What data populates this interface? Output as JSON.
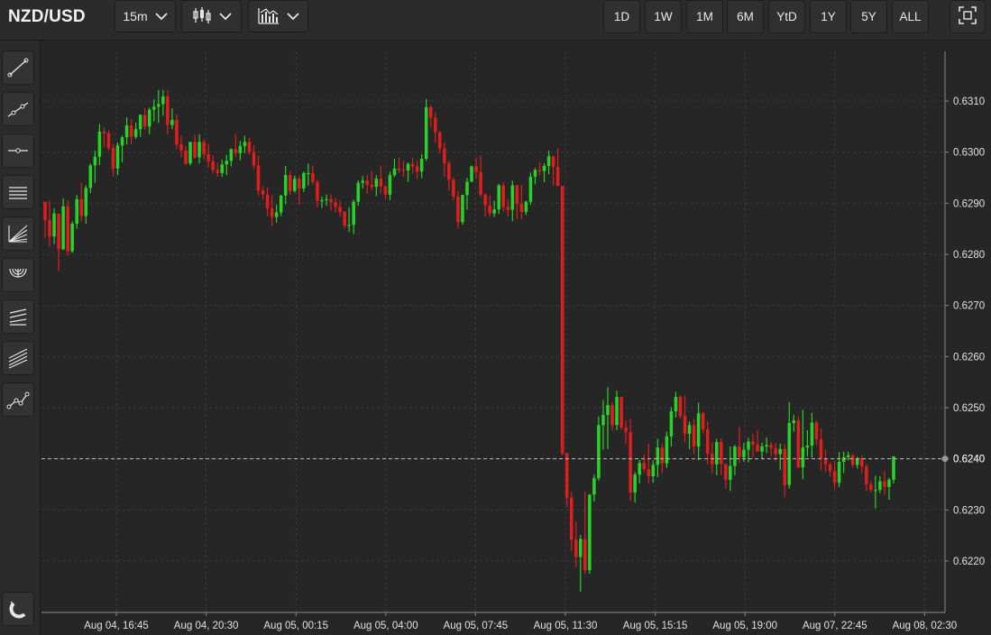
{
  "header": {
    "symbol": "NZD/USD",
    "interval": "15m",
    "chart_type_icon": "candlestick-icon",
    "indicators_icon": "indicators-icon",
    "ranges": [
      "1D",
      "1W",
      "1M",
      "6M",
      "YtD",
      "1Y",
      "5Y",
      "ALL"
    ],
    "fullscreen_icon": "fullscreen-icon"
  },
  "toolbar": {
    "tools": [
      "trend-line-icon",
      "extended-line-icon",
      "horizontal-line-icon",
      "parallel-channel-icon",
      "fan-icon",
      "arc-icon",
      "pitchfork-icon",
      "regression-channel-icon",
      "path-icon"
    ],
    "magnet_icon": "magnet-icon"
  },
  "colors": {
    "up": "#27d327",
    "down": "#e01e1e",
    "background": "#262626",
    "grid": "#3a3a3a",
    "axis_text": "#e0e0e0"
  },
  "chart_data": {
    "type": "candlestick",
    "ylim": [
      0.6212,
      0.6318
    ],
    "yticks": [
      "0.6220",
      "0.6230",
      "0.6240",
      "0.6250",
      "0.6260",
      "0.6270",
      "0.6280",
      "0.6290",
      "0.6300",
      "0.6310"
    ],
    "xticks": [
      "Aug 04, 16:45",
      "Aug 04, 20:30",
      "Aug 05, 00:15",
      "Aug 05, 04:00",
      "Aug 05, 07:45",
      "Aug 05, 11:30",
      "Aug 05, 15:15",
      "Aug 05, 19:00",
      "Aug 07, 22:45",
      "Aug 08, 02:30"
    ],
    "current_price": "0.6240",
    "candles": [
      [
        0.62903,
        0.62895,
        0.62832,
        0.62867
      ],
      [
        0.62867,
        0.62905,
        0.62815,
        0.62835
      ],
      [
        0.62835,
        0.6289,
        0.6282,
        0.6288
      ],
      [
        0.6288,
        0.62875,
        0.62767,
        0.6281
      ],
      [
        0.6281,
        0.6291,
        0.62808,
        0.62894
      ],
      [
        0.62894,
        0.62906,
        0.62797,
        0.62806
      ],
      [
        0.62806,
        0.62865,
        0.62803,
        0.6286
      ],
      [
        0.6286,
        0.62916,
        0.6285,
        0.62908
      ],
      [
        0.62908,
        0.6294,
        0.62864,
        0.62875
      ],
      [
        0.62875,
        0.62935,
        0.6286,
        0.6293
      ],
      [
        0.6293,
        0.62978,
        0.6292,
        0.62974
      ],
      [
        0.62974,
        0.63003,
        0.6294,
        0.62991
      ],
      [
        0.62991,
        0.63055,
        0.62975,
        0.6304
      ],
      [
        0.6304,
        0.63048,
        0.6301,
        0.63037
      ],
      [
        0.63037,
        0.63043,
        0.63003,
        0.63008
      ],
      [
        0.63008,
        0.63016,
        0.62953,
        0.62968
      ],
      [
        0.62968,
        0.63019,
        0.62955,
        0.63013
      ],
      [
        0.63013,
        0.63032,
        0.6298,
        0.63029
      ],
      [
        0.63029,
        0.63068,
        0.63015,
        0.63052
      ],
      [
        0.63052,
        0.63065,
        0.63015,
        0.6303
      ],
      [
        0.6303,
        0.63058,
        0.63026,
        0.63045
      ],
      [
        0.63045,
        0.63074,
        0.6303,
        0.63073
      ],
      [
        0.63073,
        0.63086,
        0.63044,
        0.6305
      ],
      [
        0.6305,
        0.63087,
        0.63035,
        0.63083
      ],
      [
        0.63083,
        0.63103,
        0.6306,
        0.63089
      ],
      [
        0.63089,
        0.63122,
        0.63057,
        0.63094
      ],
      [
        0.63094,
        0.63122,
        0.63071,
        0.63109
      ],
      [
        0.63109,
        0.63121,
        0.63035,
        0.63053
      ],
      [
        0.63053,
        0.63086,
        0.63045,
        0.63063
      ],
      [
        0.63063,
        0.63074,
        0.63006,
        0.63015
      ],
      [
        0.63015,
        0.63032,
        0.6299,
        0.63003
      ],
      [
        0.63003,
        0.63012,
        0.62975,
        0.62978
      ],
      [
        0.62978,
        0.6302,
        0.62974,
        0.6302
      ],
      [
        0.6302,
        0.63034,
        0.62987,
        0.6299
      ],
      [
        0.6299,
        0.63035,
        0.62978,
        0.6302
      ],
      [
        0.6302,
        0.63025,
        0.62986,
        0.62996
      ],
      [
        0.62996,
        0.63016,
        0.6297,
        0.62982
      ],
      [
        0.62982,
        0.62994,
        0.62958,
        0.62965
      ],
      [
        0.62965,
        0.62979,
        0.62952,
        0.62959
      ],
      [
        0.62959,
        0.62985,
        0.62952,
        0.62976
      ],
      [
        0.62976,
        0.62995,
        0.62955,
        0.62983
      ],
      [
        0.62983,
        0.63007,
        0.62972,
        0.63006
      ],
      [
        0.63006,
        0.63035,
        0.6299,
        0.62998
      ],
      [
        0.62998,
        0.63022,
        0.62984,
        0.63012
      ],
      [
        0.63012,
        0.63032,
        0.62998,
        0.6302
      ],
      [
        0.6302,
        0.63028,
        0.62995,
        0.63
      ],
      [
        0.63,
        0.63013,
        0.62967,
        0.62974
      ],
      [
        0.62974,
        0.62993,
        0.62915,
        0.62925
      ],
      [
        0.62925,
        0.62933,
        0.62907,
        0.62917
      ],
      [
        0.62917,
        0.62931,
        0.62875,
        0.6289
      ],
      [
        0.6289,
        0.62915,
        0.62856,
        0.62873
      ],
      [
        0.62873,
        0.62897,
        0.62862,
        0.62882
      ],
      [
        0.62882,
        0.62917,
        0.62875,
        0.62915
      ],
      [
        0.62915,
        0.62973,
        0.62898,
        0.62955
      ],
      [
        0.62955,
        0.62963,
        0.62916,
        0.62924
      ],
      [
        0.62924,
        0.62954,
        0.62921,
        0.62948
      ],
      [
        0.62948,
        0.62954,
        0.62897,
        0.62929
      ],
      [
        0.62929,
        0.62962,
        0.62922,
        0.62959
      ],
      [
        0.62959,
        0.62978,
        0.62935,
        0.62959
      ],
      [
        0.62959,
        0.62974,
        0.62936,
        0.62942
      ],
      [
        0.62942,
        0.62946,
        0.62892,
        0.62905
      ],
      [
        0.62905,
        0.62913,
        0.62891,
        0.62906
      ],
      [
        0.62906,
        0.62917,
        0.62895,
        0.62908
      ],
      [
        0.62908,
        0.62917,
        0.62886,
        0.62902
      ],
      [
        0.62902,
        0.6291,
        0.62882,
        0.62893
      ],
      [
        0.62893,
        0.62905,
        0.62873,
        0.62883
      ],
      [
        0.62883,
        0.62885,
        0.62851,
        0.62856
      ],
      [
        0.62856,
        0.62892,
        0.62844,
        0.62858
      ],
      [
        0.62858,
        0.62907,
        0.6284,
        0.62903
      ],
      [
        0.62903,
        0.62945,
        0.62895,
        0.6294
      ],
      [
        0.6294,
        0.62953,
        0.62929,
        0.62944
      ],
      [
        0.62944,
        0.62955,
        0.62919,
        0.62936
      ],
      [
        0.62936,
        0.62963,
        0.62926,
        0.62932
      ],
      [
        0.62932,
        0.62955,
        0.62914,
        0.62948
      ],
      [
        0.62948,
        0.62974,
        0.62919,
        0.62933
      ],
      [
        0.62933,
        0.62936,
        0.62907,
        0.62917
      ],
      [
        0.62917,
        0.62962,
        0.62906,
        0.62955
      ],
      [
        0.62955,
        0.62987,
        0.62951,
        0.62968
      ],
      [
        0.62968,
        0.62989,
        0.62959,
        0.62965
      ],
      [
        0.62965,
        0.62983,
        0.62952,
        0.62964
      ],
      [
        0.62964,
        0.6298,
        0.62942,
        0.62977
      ],
      [
        0.62977,
        0.62989,
        0.62958,
        0.62972
      ],
      [
        0.62972,
        0.62985,
        0.62947,
        0.62962
      ],
      [
        0.62962,
        0.62996,
        0.62949,
        0.62987
      ],
      [
        0.62987,
        0.63104,
        0.62983,
        0.63088
      ],
      [
        0.63088,
        0.63092,
        0.63049,
        0.63067
      ],
      [
        0.63067,
        0.63077,
        0.63018,
        0.63039
      ],
      [
        0.63039,
        0.63041,
        0.62998,
        0.63007
      ],
      [
        0.63007,
        0.63019,
        0.62952,
        0.62978
      ],
      [
        0.62978,
        0.62983,
        0.62925,
        0.62946
      ],
      [
        0.62946,
        0.62951,
        0.62906,
        0.62913
      ],
      [
        0.62913,
        0.62924,
        0.6285,
        0.62863
      ],
      [
        0.62863,
        0.62917,
        0.62858,
        0.62916
      ],
      [
        0.62916,
        0.6295,
        0.62887,
        0.62942
      ],
      [
        0.62942,
        0.62974,
        0.62942,
        0.62972
      ],
      [
        0.62972,
        0.62989,
        0.62949,
        0.62961
      ],
      [
        0.62961,
        0.62994,
        0.62912,
        0.62917
      ],
      [
        0.62917,
        0.62919,
        0.62874,
        0.62896
      ],
      [
        0.62896,
        0.62915,
        0.62873,
        0.6288
      ],
      [
        0.6288,
        0.62905,
        0.62873,
        0.62888
      ],
      [
        0.62888,
        0.62938,
        0.62879,
        0.62935
      ],
      [
        0.62935,
        0.62941,
        0.62884,
        0.62893
      ],
      [
        0.62893,
        0.62908,
        0.62874,
        0.62887
      ],
      [
        0.62887,
        0.62944,
        0.62865,
        0.62935
      ],
      [
        0.62935,
        0.62936,
        0.62869,
        0.62899
      ],
      [
        0.62899,
        0.62936,
        0.62869,
        0.62883
      ],
      [
        0.62883,
        0.62905,
        0.62877,
        0.62903
      ],
      [
        0.62903,
        0.6296,
        0.62897,
        0.62952
      ],
      [
        0.62952,
        0.62969,
        0.62937,
        0.62965
      ],
      [
        0.62965,
        0.6298,
        0.62955,
        0.62963
      ],
      [
        0.62963,
        0.62978,
        0.62941,
        0.62973
      ],
      [
        0.62973,
        0.63003,
        0.62957,
        0.62992
      ],
      [
        0.62992,
        0.62993,
        0.62935,
        0.62971
      ],
      [
        0.62971,
        0.63007,
        0.62961,
        0.62934
      ],
      [
        0.62934,
        0.62934,
        0.62407,
        0.62411
      ],
      [
        0.62411,
        0.62411,
        0.62305,
        0.62324
      ],
      [
        0.62324,
        0.62335,
        0.62219,
        0.62242
      ],
      [
        0.62242,
        0.62277,
        0.62188,
        0.62208
      ],
      [
        0.62208,
        0.62251,
        0.6214,
        0.62243
      ],
      [
        0.62243,
        0.62336,
        0.62175,
        0.62182
      ],
      [
        0.62182,
        0.62331,
        0.62175,
        0.6233
      ],
      [
        0.6233,
        0.62369,
        0.62316,
        0.62362
      ],
      [
        0.62362,
        0.62483,
        0.62357,
        0.62466
      ],
      [
        0.62466,
        0.62515,
        0.62418,
        0.62486
      ],
      [
        0.62486,
        0.6254,
        0.62419,
        0.62505
      ],
      [
        0.62505,
        0.62511,
        0.62455,
        0.62466
      ],
      [
        0.62466,
        0.62533,
        0.62456,
        0.62521
      ],
      [
        0.62521,
        0.62522,
        0.62457,
        0.62461
      ],
      [
        0.62461,
        0.62475,
        0.62429,
        0.62452
      ],
      [
        0.62452,
        0.62478,
        0.62317,
        0.62334
      ],
      [
        0.62334,
        0.62374,
        0.62314,
        0.62369
      ],
      [
        0.62369,
        0.62398,
        0.62352,
        0.62392
      ],
      [
        0.62392,
        0.62408,
        0.62374,
        0.6238
      ],
      [
        0.6238,
        0.6243,
        0.62352,
        0.62366
      ],
      [
        0.62366,
        0.62397,
        0.62353,
        0.62388
      ],
      [
        0.62388,
        0.62439,
        0.62364,
        0.62422
      ],
      [
        0.62422,
        0.62429,
        0.62372,
        0.62391
      ],
      [
        0.62391,
        0.62453,
        0.62382,
        0.62444
      ],
      [
        0.62444,
        0.62501,
        0.62424,
        0.62493
      ],
      [
        0.62493,
        0.62531,
        0.62481,
        0.62521
      ],
      [
        0.62521,
        0.62524,
        0.62479,
        0.62484
      ],
      [
        0.62484,
        0.62524,
        0.62432,
        0.62449
      ],
      [
        0.62449,
        0.62473,
        0.62419,
        0.62466
      ],
      [
        0.62466,
        0.62477,
        0.62409,
        0.62424
      ],
      [
        0.62424,
        0.6251,
        0.62397,
        0.62489
      ],
      [
        0.62489,
        0.62492,
        0.62449,
        0.62458
      ],
      [
        0.62458,
        0.62473,
        0.62389,
        0.6241
      ],
      [
        0.6241,
        0.62432,
        0.62372,
        0.62389
      ],
      [
        0.62389,
        0.62439,
        0.62368,
        0.62433
      ],
      [
        0.62433,
        0.62441,
        0.62369,
        0.6239
      ],
      [
        0.6239,
        0.6239,
        0.62341,
        0.62359
      ],
      [
        0.62359,
        0.62424,
        0.62337,
        0.62386
      ],
      [
        0.62386,
        0.62427,
        0.62368,
        0.62424
      ],
      [
        0.62424,
        0.62463,
        0.62392,
        0.62403
      ],
      [
        0.62403,
        0.62431,
        0.62394,
        0.62418
      ],
      [
        0.62418,
        0.62441,
        0.62393,
        0.62434
      ],
      [
        0.62434,
        0.62449,
        0.62402,
        0.62428
      ],
      [
        0.62428,
        0.62456,
        0.62416,
        0.62414
      ],
      [
        0.62414,
        0.62432,
        0.624,
        0.62424
      ],
      [
        0.62424,
        0.62442,
        0.62411,
        0.62427
      ],
      [
        0.62427,
        0.62433,
        0.62405,
        0.62421
      ],
      [
        0.62421,
        0.62431,
        0.62395,
        0.62409
      ],
      [
        0.62409,
        0.6243,
        0.62378,
        0.62419
      ],
      [
        0.62419,
        0.62428,
        0.62325,
        0.62349
      ],
      [
        0.62349,
        0.62511,
        0.62342,
        0.6247
      ],
      [
        0.6247,
        0.62486,
        0.62453,
        0.62475
      ],
      [
        0.62475,
        0.62483,
        0.62382,
        0.62383
      ],
      [
        0.62383,
        0.62496,
        0.6236,
        0.62422
      ],
      [
        0.62422,
        0.62456,
        0.62404,
        0.62426
      ],
      [
        0.62426,
        0.6249,
        0.62402,
        0.62471
      ],
      [
        0.62471,
        0.62475,
        0.62426,
        0.62438
      ],
      [
        0.62438,
        0.62459,
        0.62377,
        0.62401
      ],
      [
        0.62401,
        0.62418,
        0.62374,
        0.62389
      ],
      [
        0.62389,
        0.62393,
        0.62365,
        0.62376
      ],
      [
        0.62376,
        0.62396,
        0.6234,
        0.62353
      ],
      [
        0.62353,
        0.62413,
        0.62345,
        0.62394
      ],
      [
        0.62394,
        0.62414,
        0.62372,
        0.62403
      ],
      [
        0.62403,
        0.62414,
        0.62397,
        0.62407
      ],
      [
        0.62407,
        0.62411,
        0.62383,
        0.62388
      ],
      [
        0.62388,
        0.62404,
        0.62381,
        0.62401
      ],
      [
        0.62401,
        0.62406,
        0.62372,
        0.62385
      ],
      [
        0.62385,
        0.62389,
        0.62337,
        0.6235
      ],
      [
        0.6235,
        0.62356,
        0.62334,
        0.62339
      ],
      [
        0.62339,
        0.62367,
        0.62303,
        0.62339
      ],
      [
        0.62339,
        0.62366,
        0.62333,
        0.62356
      ],
      [
        0.62356,
        0.62377,
        0.62329,
        0.62345
      ],
      [
        0.62345,
        0.62363,
        0.6232,
        0.62359
      ],
      [
        0.62359,
        0.62403,
        0.62352,
        0.62405
      ]
    ]
  }
}
